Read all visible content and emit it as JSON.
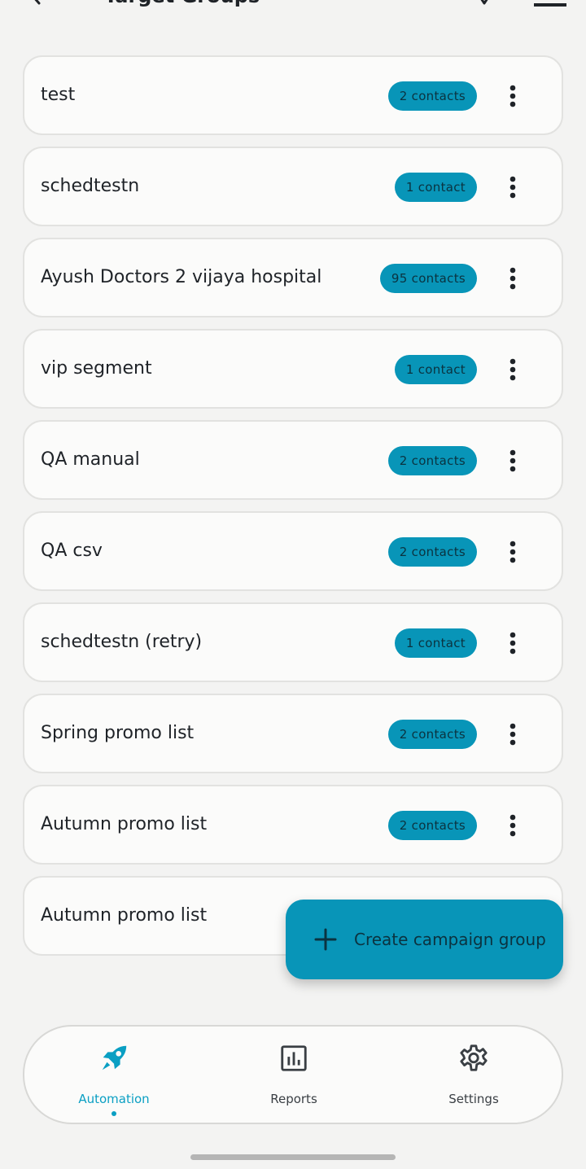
{
  "header": {
    "title": "Target Groups"
  },
  "groups": [
    {
      "name": "test",
      "badge": "2 contacts"
    },
    {
      "name": "schedtestn",
      "badge": "1 contact"
    },
    {
      "name": "Ayush Doctors 2 vijaya hospital",
      "badge": "95 contacts"
    },
    {
      "name": "vip segment",
      "badge": "1 contact"
    },
    {
      "name": "QA manual",
      "badge": "2 contacts"
    },
    {
      "name": "QA csv",
      "badge": "2 contacts"
    },
    {
      "name": "schedtestn (retry)",
      "badge": "1 contact"
    },
    {
      "name": "Spring promo list",
      "badge": "2 contacts"
    },
    {
      "name": "Autumn promo list",
      "badge": "2 contacts"
    },
    {
      "name": "Autumn promo list",
      "badge": ""
    }
  ],
  "fab": {
    "label": "Create campaign group",
    "icon": "plus-icon"
  },
  "nav": {
    "items": [
      {
        "label": "Automation",
        "icon": "rocket-icon",
        "active": true
      },
      {
        "label": "Reports",
        "icon": "bar-chart-icon",
        "active": false
      },
      {
        "label": "Settings",
        "icon": "gear-icon",
        "active": false
      }
    ]
  },
  "colors": {
    "accent": "#0895b8",
    "active_nav": "#0a9fc3",
    "background": "#f3f3f2",
    "card": "#fbfbfa"
  }
}
